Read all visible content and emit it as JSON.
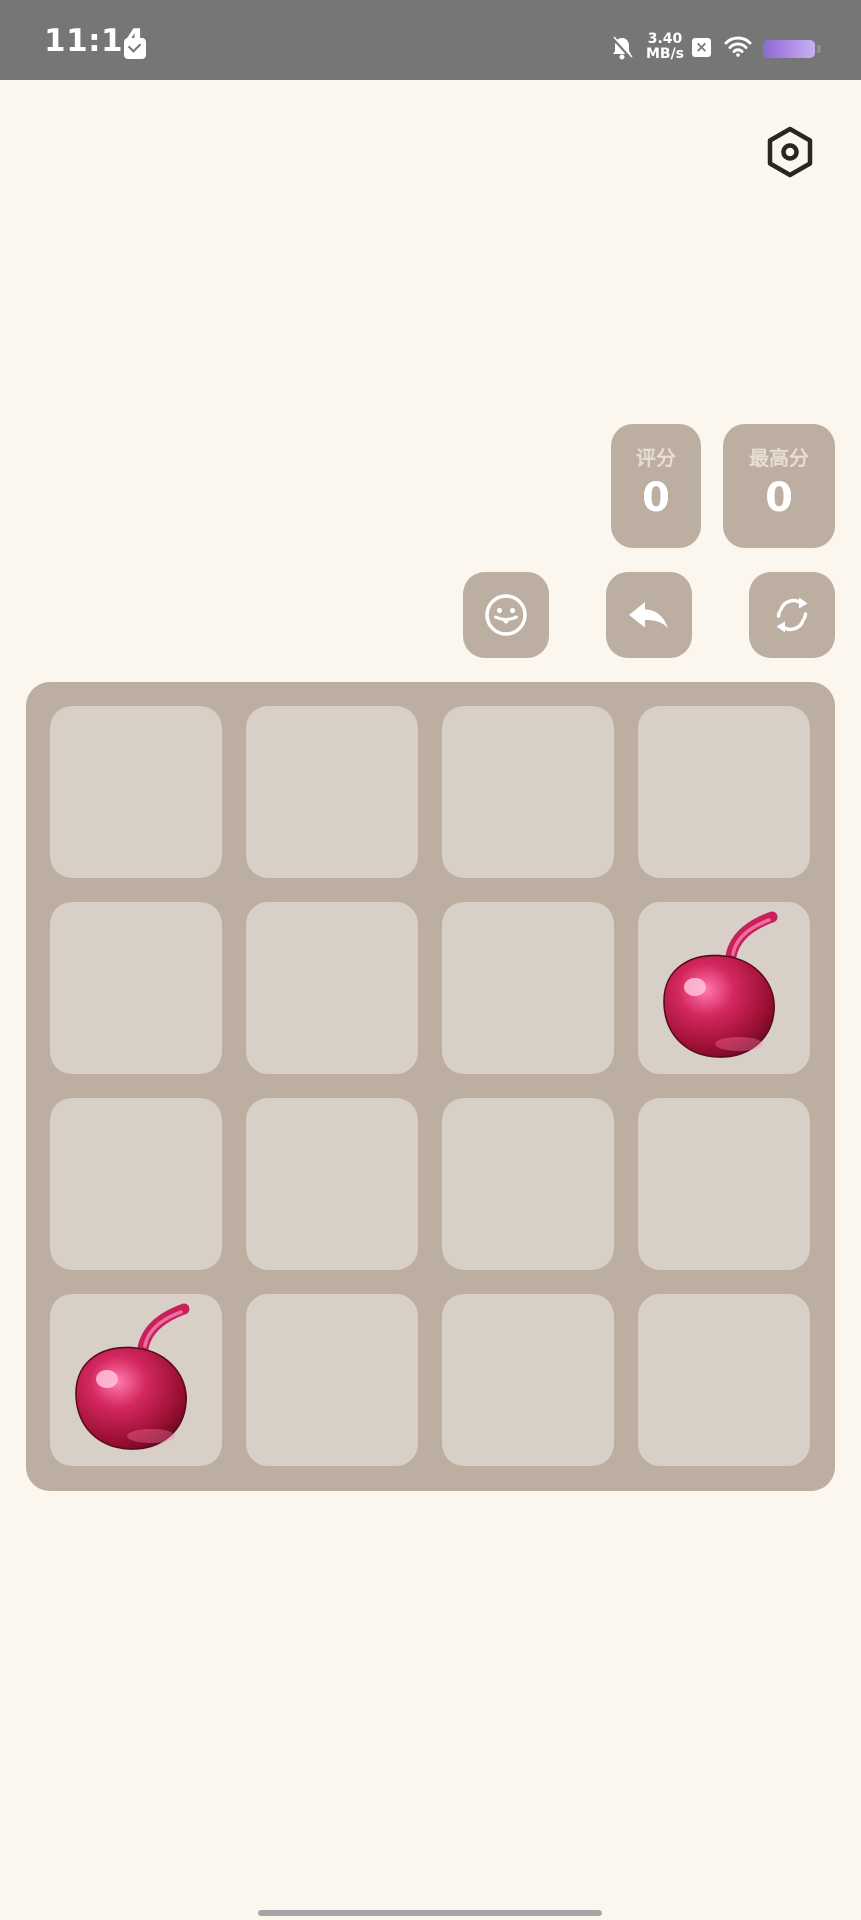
{
  "status_bar": {
    "time": "11:14",
    "net_speed_value": "3.40",
    "net_speed_unit": "MB/s",
    "close_badge": "×",
    "icons": [
      "mail-icon",
      "bell-off-icon",
      "wifi-icon",
      "battery-icon"
    ]
  },
  "scores": {
    "score_label": "评分",
    "score_value": "0",
    "best_label": "最高分",
    "best_value": "0"
  },
  "actions": {
    "icons": [
      "emoji-face-icon",
      "undo-arrow-icon",
      "restart-icon"
    ]
  },
  "board": {
    "rows": 4,
    "cols": 4,
    "tiles": [
      [
        null,
        null,
        null,
        null
      ],
      [
        null,
        null,
        null,
        "cherry"
      ],
      [
        null,
        null,
        null,
        null
      ],
      [
        "cherry",
        null,
        null,
        null
      ]
    ]
  },
  "colors": {
    "background": "#fbf7ee",
    "board": "#bcafa2",
    "empty_cell": "#d8cfc6",
    "status_bar": "#767676",
    "cherry": "#c21e52"
  }
}
